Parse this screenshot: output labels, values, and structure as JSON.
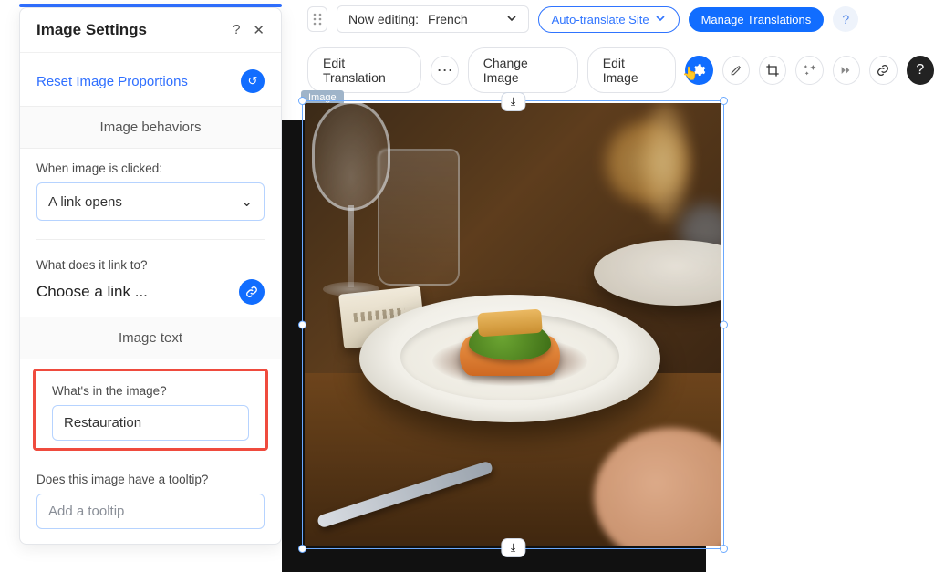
{
  "panel": {
    "title": "Image Settings",
    "reset_link": "Reset Image Proportions",
    "section_behaviors": "Image behaviors",
    "q_click": "When image is clicked:",
    "click_value": "A link opens",
    "q_linkto": "What does it link to?",
    "linkto_value": "Choose a link ...",
    "section_text": "Image text",
    "q_whats_in": "What's in the image?",
    "whats_in_value": "Restauration",
    "q_tooltip": "Does this image have a tooltip?",
    "tooltip_placeholder": "Add a tooltip"
  },
  "toolbar": {
    "editing_prefix": "Now editing:",
    "editing_lang": "French",
    "auto_translate": "Auto-translate Site",
    "manage": "Manage Translations",
    "edit_translation": "Edit Translation",
    "change_image": "Change Image",
    "edit_image": "Edit Image"
  },
  "canvas": {
    "image_tag": "Image"
  },
  "glyph": {
    "help": "?",
    "close": "✕",
    "undo": "↺",
    "chev_down": "⌄",
    "link": "🔗",
    "download": "⤓",
    "dots": "⋯",
    "cursor": "👆"
  }
}
